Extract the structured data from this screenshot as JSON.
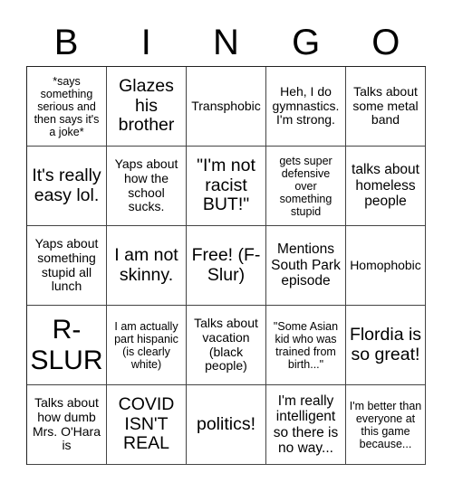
{
  "header": {
    "letters": [
      "B",
      "I",
      "N",
      "G",
      "O"
    ]
  },
  "cells": [
    [
      "*says something serious and then says it's a joke*",
      "Glazes his brother",
      "Transphobic",
      "Heh, I do gymnastics. I'm strong.",
      "Talks about some metal band"
    ],
    [
      "It's really easy lol.",
      "Yaps about how the school sucks.",
      "\"I'm not racist BUT!\"",
      "gets super defensive over something stupid",
      "talks about homeless people"
    ],
    [
      "Yaps about something stupid all lunch",
      "I am not skinny.",
      "Free! (F-Slur)",
      "Mentions South Park episode",
      "Homophobic"
    ],
    [
      "R-SLUR",
      "I am actually part hispanic (is clearly white)",
      "Talks about vacation (black people)",
      "\"Some Asian kid who was trained from birth...\"",
      "Flordia is so great!"
    ],
    [
      "Talks about how dumb Mrs. O'Hara is",
      "COVID ISN'T REAL",
      "politics!",
      "I'm really intelligent so there is no way...",
      "I'm better than everyone at this game because..."
    ]
  ],
  "colors": {
    "grid_line": "#444444",
    "text": "#000000",
    "background": "#ffffff"
  }
}
